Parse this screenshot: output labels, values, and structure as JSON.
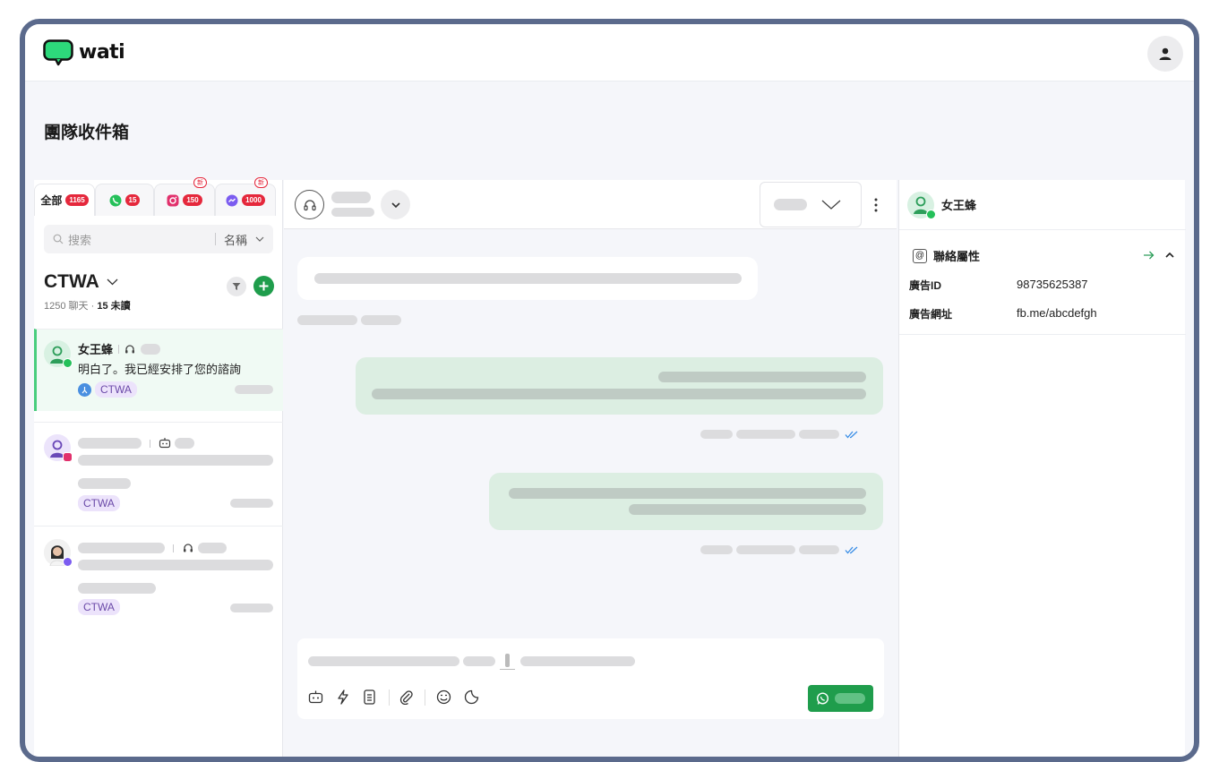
{
  "app": {
    "logo_text": "wati",
    "brand_color": "#1f9d4c"
  },
  "page": {
    "title": "團隊收件箱"
  },
  "inbox": {
    "tabs": [
      {
        "label": "全部",
        "count": "1165"
      },
      {
        "icon": "whatsapp-icon",
        "count": "15"
      },
      {
        "icon": "instagram-icon",
        "count": "150",
        "new": "新"
      },
      {
        "icon": "messenger-icon",
        "count": "1000",
        "new": "新"
      }
    ],
    "search_placeholder": "搜索",
    "sort_label": "名稱",
    "filter_title": "CTWA",
    "stats_chats": "1250 聊天",
    "stats_separator": "·",
    "stats_unread": "15 未讀"
  },
  "conversations": [
    {
      "name": "女王蜂",
      "message": "明白了。我已經安排了您的諮詢",
      "tag": "CTWA",
      "channel": "whatsapp"
    },
    {
      "tag": "CTWA",
      "channel": "instagram"
    },
    {
      "tag": "CTWA",
      "channel": "messenger"
    }
  ],
  "contact": {
    "name": "女王蜂",
    "section_title": "聯絡屬性",
    "attributes": [
      {
        "key": "廣告ID",
        "value": "98735625387"
      },
      {
        "key": "廣告網址",
        "value": "fb.me/abcdefgh"
      }
    ]
  }
}
